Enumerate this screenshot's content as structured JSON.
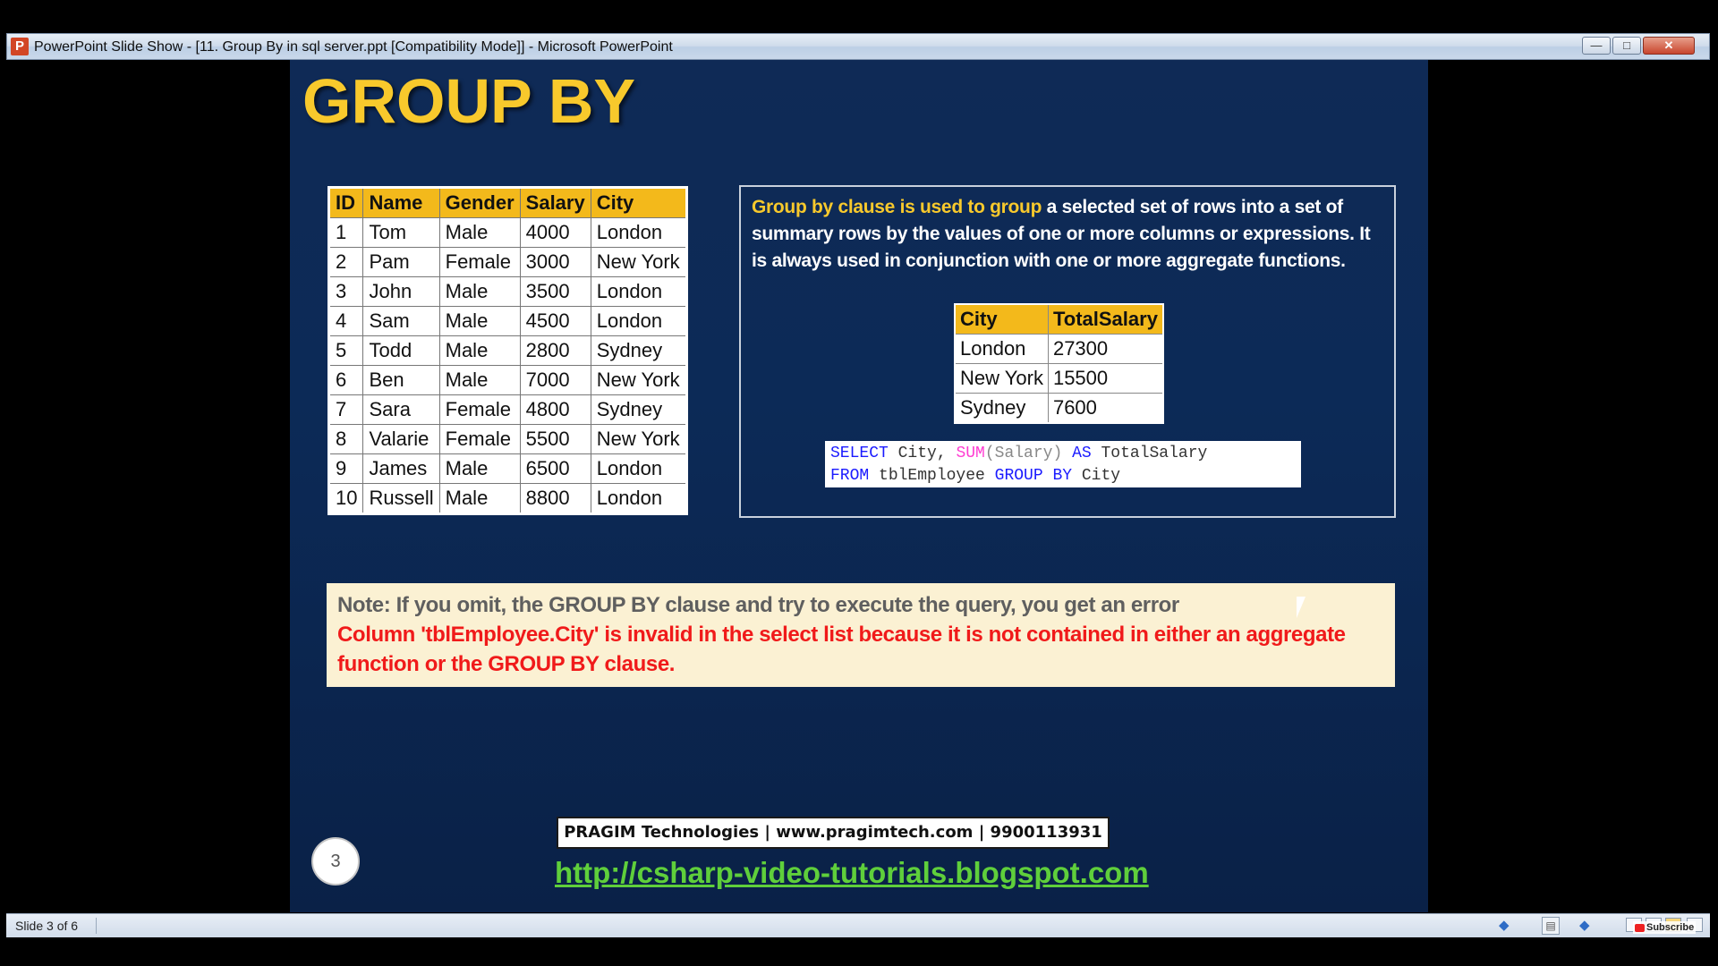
{
  "window": {
    "icon_glyph": "P",
    "title": "PowerPoint Slide Show - [11. Group By in sql server.ppt [Compatibility Mode]] - Microsoft PowerPoint",
    "buttons": {
      "minimize_glyph": "—",
      "maximize_glyph": "□",
      "close_glyph": "✕"
    }
  },
  "slide": {
    "title": "GROUP BY",
    "employee_table": {
      "headers": [
        "ID",
        "Name",
        "Gender",
        "Salary",
        "City"
      ],
      "rows": [
        [
          "1",
          "Tom",
          "Male",
          "4000",
          "London"
        ],
        [
          "2",
          "Pam",
          "Female",
          "3000",
          "New York"
        ],
        [
          "3",
          "John",
          "Male",
          "3500",
          "London"
        ],
        [
          "4",
          "Sam",
          "Male",
          "4500",
          "London"
        ],
        [
          "5",
          "Todd",
          "Male",
          "2800",
          "Sydney"
        ],
        [
          "6",
          "Ben",
          "Male",
          "7000",
          "New York"
        ],
        [
          "7",
          "Sara",
          "Female",
          "4800",
          "Sydney"
        ],
        [
          "8",
          "Valarie",
          "Female",
          "5500",
          "New York"
        ],
        [
          "9",
          "James",
          "Male",
          "6500",
          "London"
        ],
        [
          "10",
          "Russell",
          "Male",
          "8800",
          "London"
        ]
      ]
    },
    "info": {
      "highlight": "Group by clause is used to group",
      "text": " a selected set of rows into a set of summary rows by the values of one or more columns or expressions. It is always used in conjunction with one or more aggregate functions.",
      "summary_table": {
        "headers": [
          "City",
          "TotalSalary"
        ],
        "rows": [
          [
            "London",
            "27300"
          ],
          [
            "New York",
            "15500"
          ],
          [
            "Sydney",
            "7600"
          ]
        ]
      },
      "code": {
        "select": "SELECT",
        "city1": " City, ",
        "sum": "SUM",
        "salary": "(Salary)",
        "as": "AS",
        "alias": " TotalSalary",
        "from": "FROM",
        "table": " tblEmployee ",
        "groupby": "GROUP BY",
        "city2": " City"
      }
    },
    "note": {
      "line1": "Note: If you omit, the GROUP BY clause and try to execute the query, you get an error",
      "line2": "Column 'tblEmployee.City' is invalid in the select list because it is not contained in either an aggregate function or the GROUP BY clause."
    },
    "footer": {
      "company": "PRAGIM Technologies | www.pragimtech.com | 9900113931",
      "slide_number": "3",
      "link": "http://csharp-video-tutorials.blogspot.com"
    }
  },
  "statusbar": {
    "slide_indicator": "Slide 3 of 6",
    "prev_glyph": "◆",
    "menu_glyph": "▤",
    "next_glyph": "◆",
    "subscribe_label": "Subscribe"
  },
  "colors": {
    "slide_background": "#0c2a57",
    "title_accent": "#f8c92c",
    "table_header": "#f3b91b",
    "error_text": "#f01a1a",
    "link": "#5fcf3b"
  }
}
